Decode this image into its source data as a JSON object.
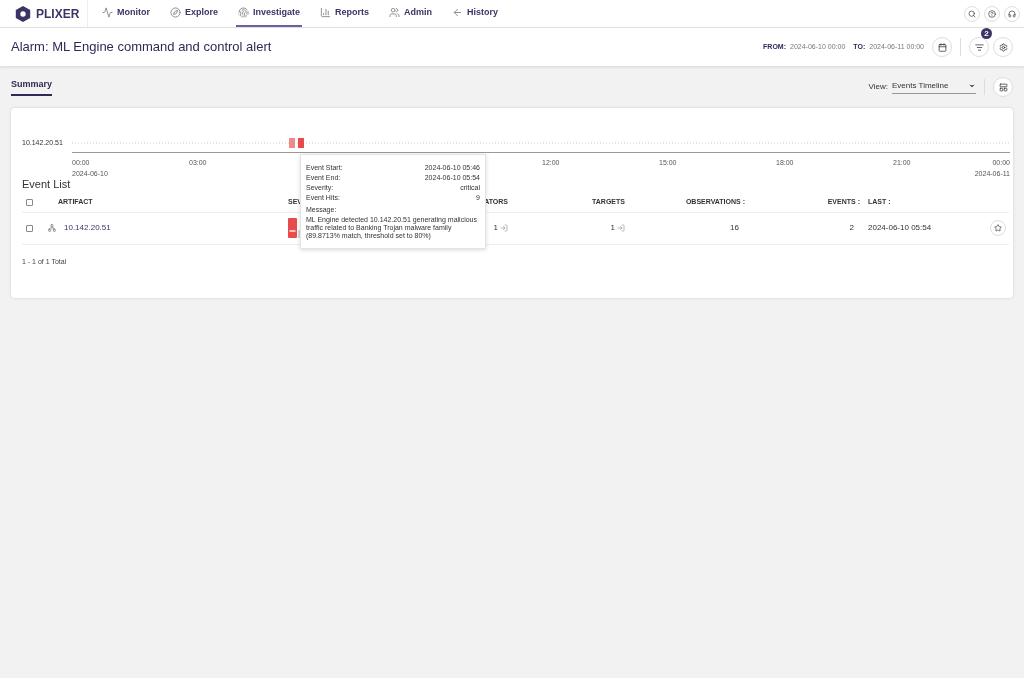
{
  "brand": "PLIXER",
  "nav": [
    {
      "label": "Monitor",
      "selected": false
    },
    {
      "label": "Explore",
      "selected": false
    },
    {
      "label": "Investigate",
      "selected": true
    },
    {
      "label": "Reports",
      "selected": false
    },
    {
      "label": "Admin",
      "selected": false
    },
    {
      "label": "History",
      "selected": false
    }
  ],
  "title": "Alarm: ML Engine command and control alert",
  "range": {
    "from_label": "FROM:",
    "from": "2024-06-10 00:00",
    "to_label": "TO:",
    "to": "2024-06-11 00:00"
  },
  "filter_badge": "2",
  "tabs": [
    {
      "label": "Summary",
      "selected": true
    }
  ],
  "view": {
    "label": "View:",
    "value": "Events Timeline"
  },
  "timeline": {
    "row_label": "10.142.20.51",
    "ticks_left": [
      {
        "time": "00:00",
        "date": "2024-06-10"
      },
      {
        "time": "03:00"
      }
    ],
    "ticks_right": [
      {
        "time": "12:00"
      },
      {
        "time": "15:00"
      },
      {
        "time": "18:00"
      },
      {
        "time": "21:00"
      },
      {
        "time": "00:00",
        "date": "2024-06-11"
      }
    ]
  },
  "tooltip": {
    "rows": [
      {
        "label": "Event Start:",
        "value": "2024-06-10 05:46"
      },
      {
        "label": "Event End:",
        "value": "2024-06-10 05:54"
      },
      {
        "label": "Severity:",
        "value": "critical"
      },
      {
        "label": "Event Hits:",
        "value": "9"
      }
    ],
    "message_label": "Message:",
    "message": "ML Engine detected 10.142.20.51 generating malicious traffic related to Banking Trojan malware family (89.8713% match, threshold set to 80%)"
  },
  "event_list": {
    "title": "Event List",
    "all_checked": false,
    "columns": [
      "ARTIFACT",
      "SEV",
      "ATORS",
      "TARGETS",
      "OBSERVATIONS :",
      "EVENTS :",
      "LAST :"
    ],
    "rows": [
      {
        "checked": false,
        "artifact": "10.142.20.51",
        "indicators": "1",
        "targets": "1",
        "observations": "16",
        "events": "2",
        "last": "2024-06-10 05:54",
        "starred": false
      }
    ],
    "footer": "1 - 1 of 1 Total"
  }
}
